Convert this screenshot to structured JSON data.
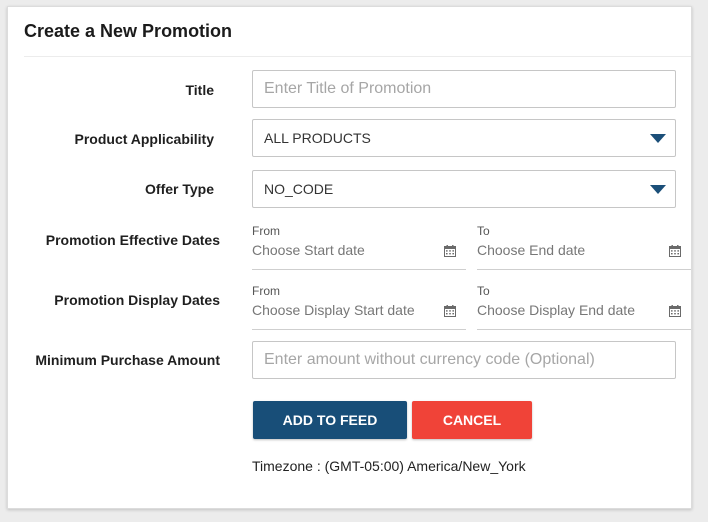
{
  "form": {
    "title": "Create a New Promotion",
    "fields": {
      "title": {
        "label": "Title",
        "placeholder": "Enter Title of Promotion"
      },
      "product_applicability": {
        "label": "Product Applicability",
        "value": "ALL PRODUCTS"
      },
      "offer_type": {
        "label": "Offer Type",
        "value": "NO_CODE"
      },
      "effective_dates": {
        "label": "Promotion Effective Dates",
        "from_label": "From",
        "from_placeholder": "Choose Start date",
        "to_label": "To",
        "to_placeholder": "Choose End date"
      },
      "display_dates": {
        "label": "Promotion Display Dates",
        "from_label": "From",
        "from_placeholder": "Choose Display Start date",
        "to_label": "To",
        "to_placeholder": "Choose Display End date"
      },
      "minimum_purchase": {
        "label": "Minimum Purchase Amount",
        "placeholder": "Enter amount without currency code (Optional)"
      }
    },
    "buttons": {
      "add_to_feed": "ADD TO FEED",
      "cancel": "CANCEL"
    },
    "timezone": "Timezone : (GMT-05:00) America/New_York"
  },
  "colors": {
    "primary": "#184e78",
    "danger": "#f04338",
    "caret": "#1b4f79"
  },
  "icons": {
    "date": "calendar-icon",
    "dropdown": "caret-down-icon"
  }
}
